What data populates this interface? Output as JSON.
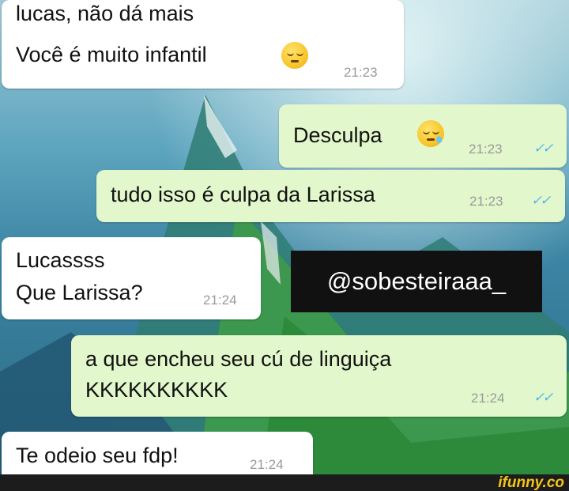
{
  "messages": [
    {
      "lines": [
        "lucas, não dá mais",
        "Você é muito infantil"
      ],
      "time": "21:23",
      "emoji": "pensive-face"
    },
    {
      "text": "Desculpa",
      "time": "21:23",
      "ticks": "✓✓",
      "emoji": "sleepy-face"
    },
    {
      "text": "tudo isso é culpa da Larissa",
      "time": "21:23",
      "ticks": "✓✓"
    },
    {
      "lines": [
        "Lucassss",
        "Que Larissa?"
      ],
      "time": "21:24"
    },
    {
      "lines": [
        "a que encheu seu cú de linguiça",
        "KKKKKKKKKK"
      ],
      "time": "21:24",
      "ticks": "✓✓"
    },
    {
      "text": "Te odeio seu fdp!",
      "time": "21:24"
    }
  ],
  "watermark": "@sobesteiraaa_",
  "footer": {
    "logo": "ifunny.co"
  },
  "colors": {
    "incoming": "#ffffff",
    "outgoing": "#e2f7cb",
    "tick": "#4fb6ec",
    "logo": "#f5c518"
  }
}
